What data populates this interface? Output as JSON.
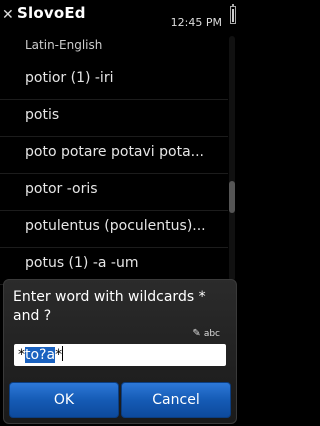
{
  "status": {
    "app_title": "SlovoEd",
    "clock": "12:45 PM"
  },
  "list": {
    "dictionary": "Latin-English",
    "items": [
      "potior (1) -iri",
      "potis",
      "poto potare potavi pota...",
      "potor -oris",
      "potulentus (poculentus)...",
      "potus (1) -a -um"
    ]
  },
  "dialog": {
    "prompt": "Enter word with wildcards * and ?",
    "mode_label": "abc",
    "input_prefix": "*",
    "input_selected": "to?a",
    "input_suffix": "*",
    "ok_label": "OK",
    "cancel_label": "Cancel"
  }
}
